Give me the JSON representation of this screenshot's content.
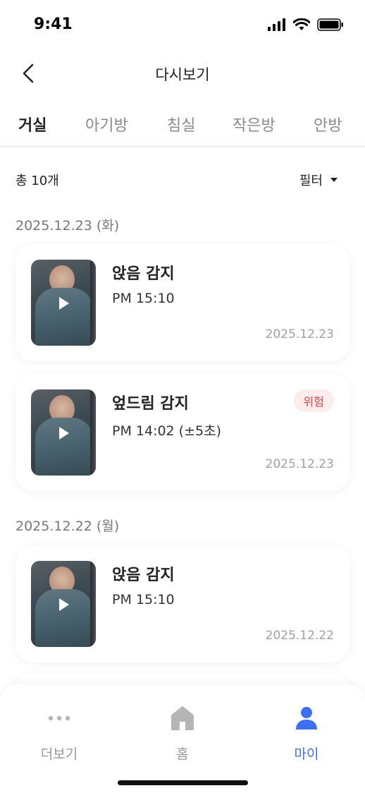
{
  "status_bar": {
    "time": "9:41"
  },
  "header": {
    "title": "다시보기"
  },
  "tabs": [
    {
      "label": "거실",
      "active": true
    },
    {
      "label": "아기방",
      "active": false
    },
    {
      "label": "침실",
      "active": false
    },
    {
      "label": "작은방",
      "active": false
    },
    {
      "label": "안방",
      "active": false
    }
  ],
  "summary": {
    "total": "총 10개",
    "filter_label": "필터"
  },
  "groups": [
    {
      "date": "2025.12.23 (화)",
      "items": [
        {
          "title": "앉음 감지",
          "time": "PM 15:10",
          "date": "2025.12.23",
          "badge": ""
        },
        {
          "title": "엎드림 감지",
          "time": "PM 14:02 (±5초)",
          "date": "2025.12.23",
          "badge": "위험"
        }
      ]
    },
    {
      "date": "2025.12.22 (월)",
      "items": [
        {
          "title": "앉음 감지",
          "time": "PM 15:10",
          "date": "2025.12.22",
          "badge": ""
        }
      ]
    }
  ],
  "bottom_nav": [
    {
      "label": "더보기",
      "icon": "more-icon",
      "active": false
    },
    {
      "label": "홈",
      "icon": "home-icon",
      "active": false
    },
    {
      "label": "마이",
      "icon": "person-icon",
      "active": true
    }
  ],
  "colors": {
    "accent": "#3d6ff5",
    "danger": "#e0454b",
    "danger_bg": "#fdecec"
  }
}
